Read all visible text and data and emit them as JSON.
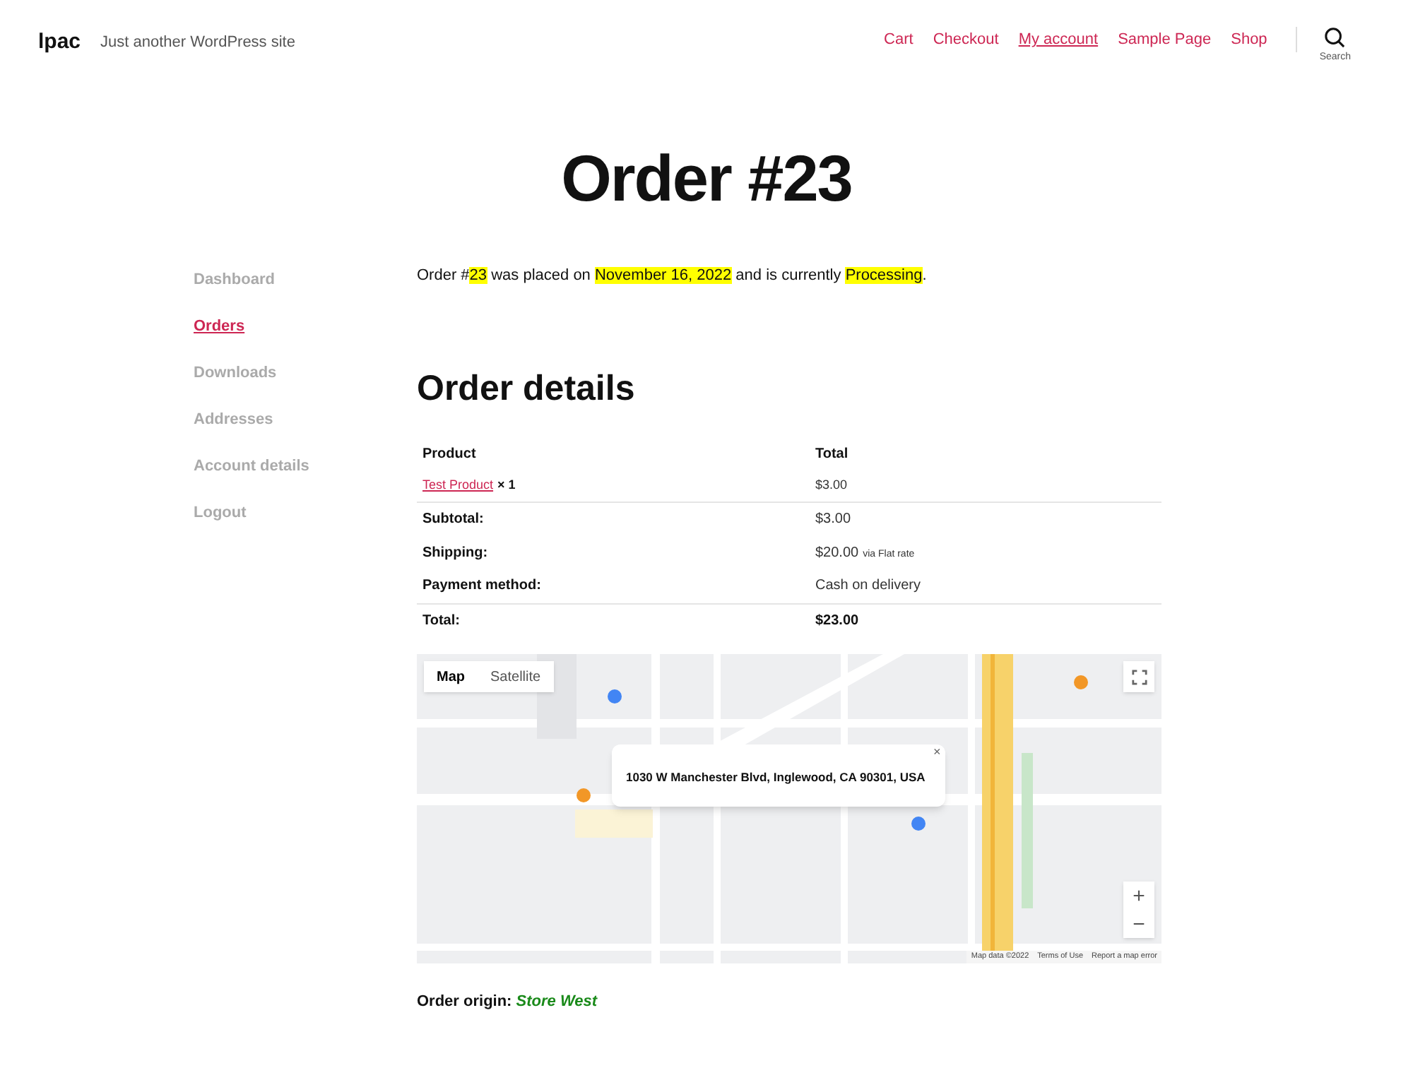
{
  "header": {
    "site_title": "lpac",
    "tagline": "Just another WordPress site",
    "nav": [
      {
        "label": "Cart",
        "selected": false
      },
      {
        "label": "Checkout",
        "selected": false
      },
      {
        "label": "My account",
        "selected": true
      },
      {
        "label": "Sample Page",
        "selected": false
      },
      {
        "label": "Shop",
        "selected": false
      }
    ],
    "search_label": "Search"
  },
  "page_title": "Order #23",
  "account_menu": [
    {
      "label": "Dashboard",
      "selected": false
    },
    {
      "label": "Orders",
      "selected": true
    },
    {
      "label": "Downloads",
      "selected": false
    },
    {
      "label": "Addresses",
      "selected": false
    },
    {
      "label": "Account details",
      "selected": false
    },
    {
      "label": "Logout",
      "selected": false
    }
  ],
  "status_sentence": [
    {
      "text": "Order #",
      "highlighted": false
    },
    {
      "text": "23",
      "highlighted": true
    },
    {
      "text": " was placed on ",
      "highlighted": false
    },
    {
      "text": "November 16, 2022",
      "highlighted": true
    },
    {
      "text": " and is currently ",
      "highlighted": false
    },
    {
      "text": "Processing",
      "highlighted": true
    },
    {
      "text": ".",
      "highlighted": false
    }
  ],
  "order_details": {
    "title": "Order details",
    "columns": [
      "Product",
      "Total"
    ],
    "product_row": {
      "product": "Test Product",
      "quantity": "× 1",
      "total": "$3.00"
    },
    "totals": [
      {
        "label": "Subtotal:",
        "value": "$3.00"
      },
      {
        "label": "Shipping:",
        "value": "$20.00",
        "note": "via Flat rate"
      },
      {
        "label": "Payment method:",
        "value": "Cash on delivery"
      },
      {
        "label": "Total:",
        "value": "$23.00"
      }
    ]
  },
  "map": {
    "kind": "picture",
    "types": [
      {
        "label": "Map",
        "selected": true
      },
      {
        "label": "Satellite",
        "selected": false
      }
    ],
    "info_window": "1030 W Manchester Blvd, Inglewood, CA 90301, USA",
    "close": "×",
    "zoom_in": "+",
    "zoom_out": "−",
    "footer": [
      "Map data ©2022",
      "Terms of Use",
      "Report a map error"
    ]
  },
  "order_origin": {
    "label": "Order origin:",
    "value": "Store West"
  }
}
